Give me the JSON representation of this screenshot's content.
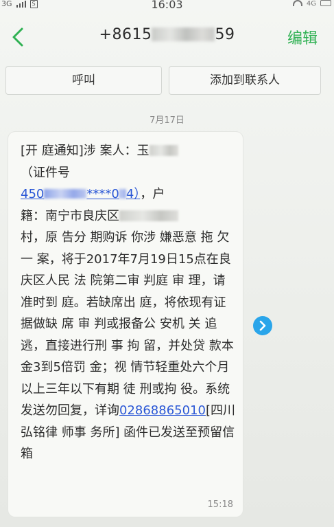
{
  "status_bar": {
    "signal_text": "3G",
    "sim_label": "S",
    "time": "16:03",
    "network": "4G"
  },
  "header": {
    "number_prefix": "+8615",
    "number_suffix": "59",
    "edit_label": "编辑"
  },
  "actions": {
    "call_label": "呼叫",
    "add_contact_label": "添加到联系人"
  },
  "date_label": "7月17日",
  "message": {
    "line1_prefix": "[开 庭通知]涉 案人：玉",
    "line2": "（证件号",
    "id_prefix": "450",
    "id_mid": "****0",
    "id_end": "4）",
    "line3_suffix": "，户",
    "line4_prefix": "籍：南宁市良庆区",
    "body": "村，原 告分 期购诉 你涉 嫌恶意 拖 欠一 案，将于2017年7月19日15点在良庆区人民 法 院第二审 判庭 审 理，请准时到 庭。若缺席出 庭，将依现有证 据做缺 席 审 判或报备公 安机 关 追逃，直接进行刑 事 拘 留，并处贷 款本 金3到5倍罚 金；视 情节轻重处六个月以上三年以下有期 徒 刑或拘 役。系统发送勿回复，详询",
    "phone_link": "02868865010",
    "tail": "[四川弘铭律 师事 务所] 函件已发送至预留信箱",
    "time": "15:18"
  },
  "colors": {
    "accent_green": "#2fb153",
    "link_blue": "#2a57d6",
    "forward_blue": "#2aa5ea"
  },
  "icons": {
    "back": "chevron-left-icon",
    "forward": "chevron-right-icon"
  }
}
